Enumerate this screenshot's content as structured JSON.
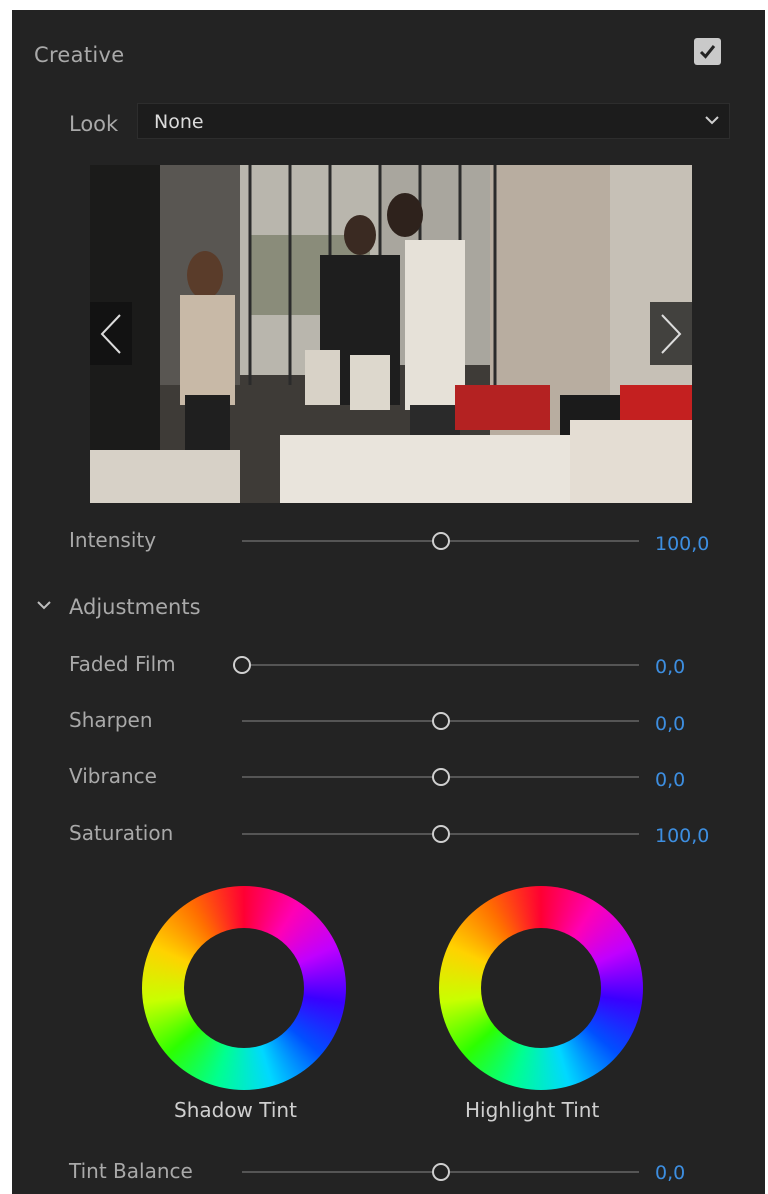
{
  "section": {
    "title": "Creative",
    "enabled": true
  },
  "look": {
    "label": "Look",
    "selected": "None"
  },
  "preview": {
    "image_description": "photo of people standing at a table in a bright room"
  },
  "intensity": {
    "label": "Intensity",
    "value": "100,0",
    "fraction": 0.5
  },
  "adjustments": {
    "label": "Adjustments",
    "expanded": true,
    "sliders": [
      {
        "label": "Faded Film",
        "value": "0,0",
        "fraction": 0.0
      },
      {
        "label": "Sharpen",
        "value": "0,0",
        "fraction": 0.5
      },
      {
        "label": "Vibrance",
        "value": "0,0",
        "fraction": 0.5
      },
      {
        "label": "Saturation",
        "value": "100,0",
        "fraction": 0.5
      }
    ]
  },
  "tints": {
    "shadow_label": "Shadow Tint",
    "highlight_label": "Highlight Tint"
  },
  "tint_balance": {
    "label": "Tint Balance",
    "value": "0,0",
    "fraction": 0.5
  },
  "colors": {
    "accent": "#3d8ee0",
    "panel": "#232323",
    "text": "#a9a9a9"
  }
}
